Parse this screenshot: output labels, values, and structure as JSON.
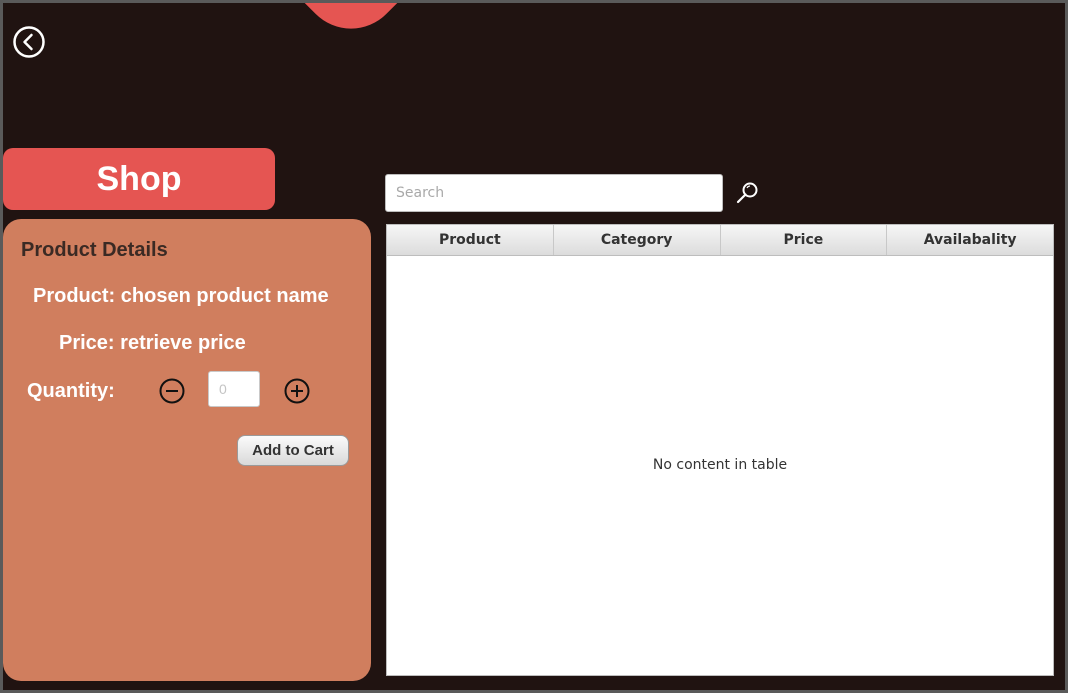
{
  "colors": {
    "background": "#201311",
    "accent": "#e55552",
    "panel": "#d07e5e",
    "panel_title": "#3a2a24"
  },
  "header": {
    "back_icon": "chevron-left-circle-icon",
    "banner_title": "Shop"
  },
  "product_details": {
    "title": "Product Details",
    "product_label": "Product:",
    "product_value": "chosen product name",
    "price_label": "Price:",
    "price_value": "retrieve price",
    "quantity_label": "Quantity:",
    "quantity_placeholder": "0",
    "minus_icon": "minus-circle-icon",
    "plus_icon": "plus-circle-icon",
    "add_to_cart_label": "Add to Cart"
  },
  "search": {
    "placeholder": "Search",
    "icon": "magnifier-icon"
  },
  "table": {
    "columns": [
      "Product",
      "Category",
      "Price",
      "Availabality"
    ],
    "empty_text": "No content in table"
  }
}
